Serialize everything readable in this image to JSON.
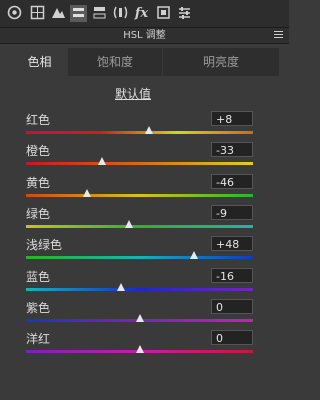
{
  "toolbar": {
    "icons": [
      "aperture-icon",
      "grid-icon",
      "mountain-icon",
      "hsl-icon",
      "split-toning-icon",
      "lens-icon",
      "fx-icon",
      "camera-calibration-icon",
      "sliders-icon"
    ],
    "active_index": 3
  },
  "panel": {
    "title": "HSL 调整",
    "menu_icon": "menu-icon"
  },
  "tabs": [
    {
      "label": "色相",
      "active": true
    },
    {
      "label": "饱和度",
      "active": false
    },
    {
      "label": "明亮度",
      "active": false
    }
  ],
  "default_label": "默认值",
  "rows": [
    {
      "label": "红色",
      "value": "+8",
      "amount": 8,
      "track_colors": [
        "#c8103b",
        "#cf2016",
        "#d2d616",
        "#d5680e"
      ]
    },
    {
      "label": "橙色",
      "value": "-33",
      "amount": -33,
      "track_colors": [
        "#c81720",
        "#d86a14",
        "#dfd21a"
      ]
    },
    {
      "label": "黄色",
      "value": "-46",
      "amount": -46,
      "track_colors": [
        "#d04813",
        "#d8c21a",
        "#28b526"
      ]
    },
    {
      "label": "绿色",
      "value": "-9",
      "amount": -9,
      "track_colors": [
        "#c7c21a",
        "#2bb628",
        "#1bb6a7"
      ]
    },
    {
      "label": "浅绿色",
      "value": "+48",
      "amount": 48,
      "track_colors": [
        "#25b623",
        "#17b3b4",
        "#1238c4"
      ]
    },
    {
      "label": "蓝色",
      "value": "-16",
      "amount": -16,
      "track_colors": [
        "#16b3b8",
        "#1a2bc6",
        "#7a20c0"
      ]
    },
    {
      "label": "紫色",
      "value": "0",
      "amount": 0,
      "track_colors": [
        "#1f32c6",
        "#7b22c2",
        "#c71fb9"
      ]
    },
    {
      "label": "洋红",
      "value": "0",
      "amount": 0,
      "track_colors": [
        "#7d1fbf",
        "#c81ca8",
        "#c8173a"
      ]
    }
  ]
}
